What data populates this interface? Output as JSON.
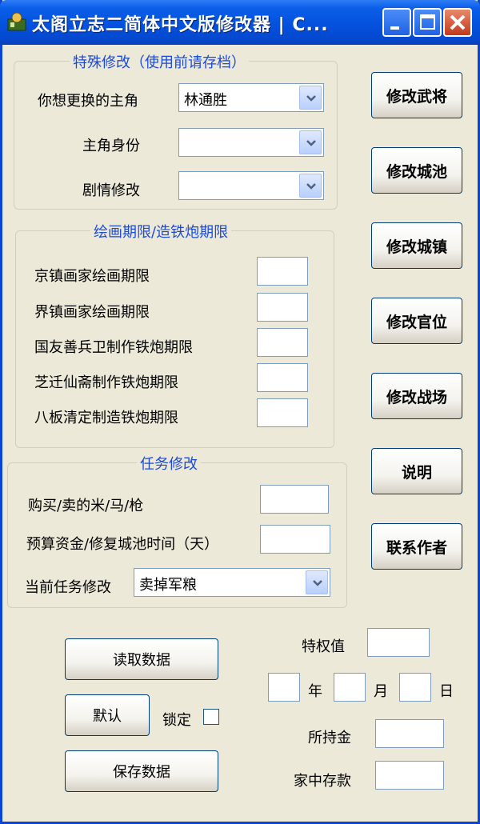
{
  "window": {
    "title": "太阁立志二简体中文版修改器 | C..."
  },
  "special": {
    "legend": "特殊修改（使用前请存档）",
    "protagonist_label": "你想更换的主角",
    "protagonist_value": "林通胜",
    "identity_label": "主角身份",
    "identity_value": "",
    "story_label": "剧情修改",
    "story_value": ""
  },
  "painting": {
    "legend": "绘画期限/造铁炮期限",
    "rows": [
      "京镇画家绘画期限",
      "界镇画家绘画期限",
      "国友善兵卫制作铁炮期限",
      "芝迁仙斋制作铁炮期限",
      "八板清定制造铁炮期限"
    ]
  },
  "mission": {
    "legend": "任务修改",
    "buy_label": "购买/卖的米/马/枪",
    "budget_label": "预算资金/修复城池时间（天）",
    "current_label": "当前任务修改",
    "current_value": "卖掉军粮"
  },
  "right_buttons": [
    "修改武将",
    "修改城池",
    "修改城镇",
    "修改官位",
    "修改战场",
    "说明",
    "联系作者"
  ],
  "bottom": {
    "read_button": "读取数据",
    "default_button": "默认",
    "lock_label": "锁定",
    "save_button": "保存数据",
    "privilege_label": "特权值",
    "year_label": "年",
    "month_label": "月",
    "day_label": "日",
    "money_label": "所持金",
    "savings_label": "家中存款"
  }
}
